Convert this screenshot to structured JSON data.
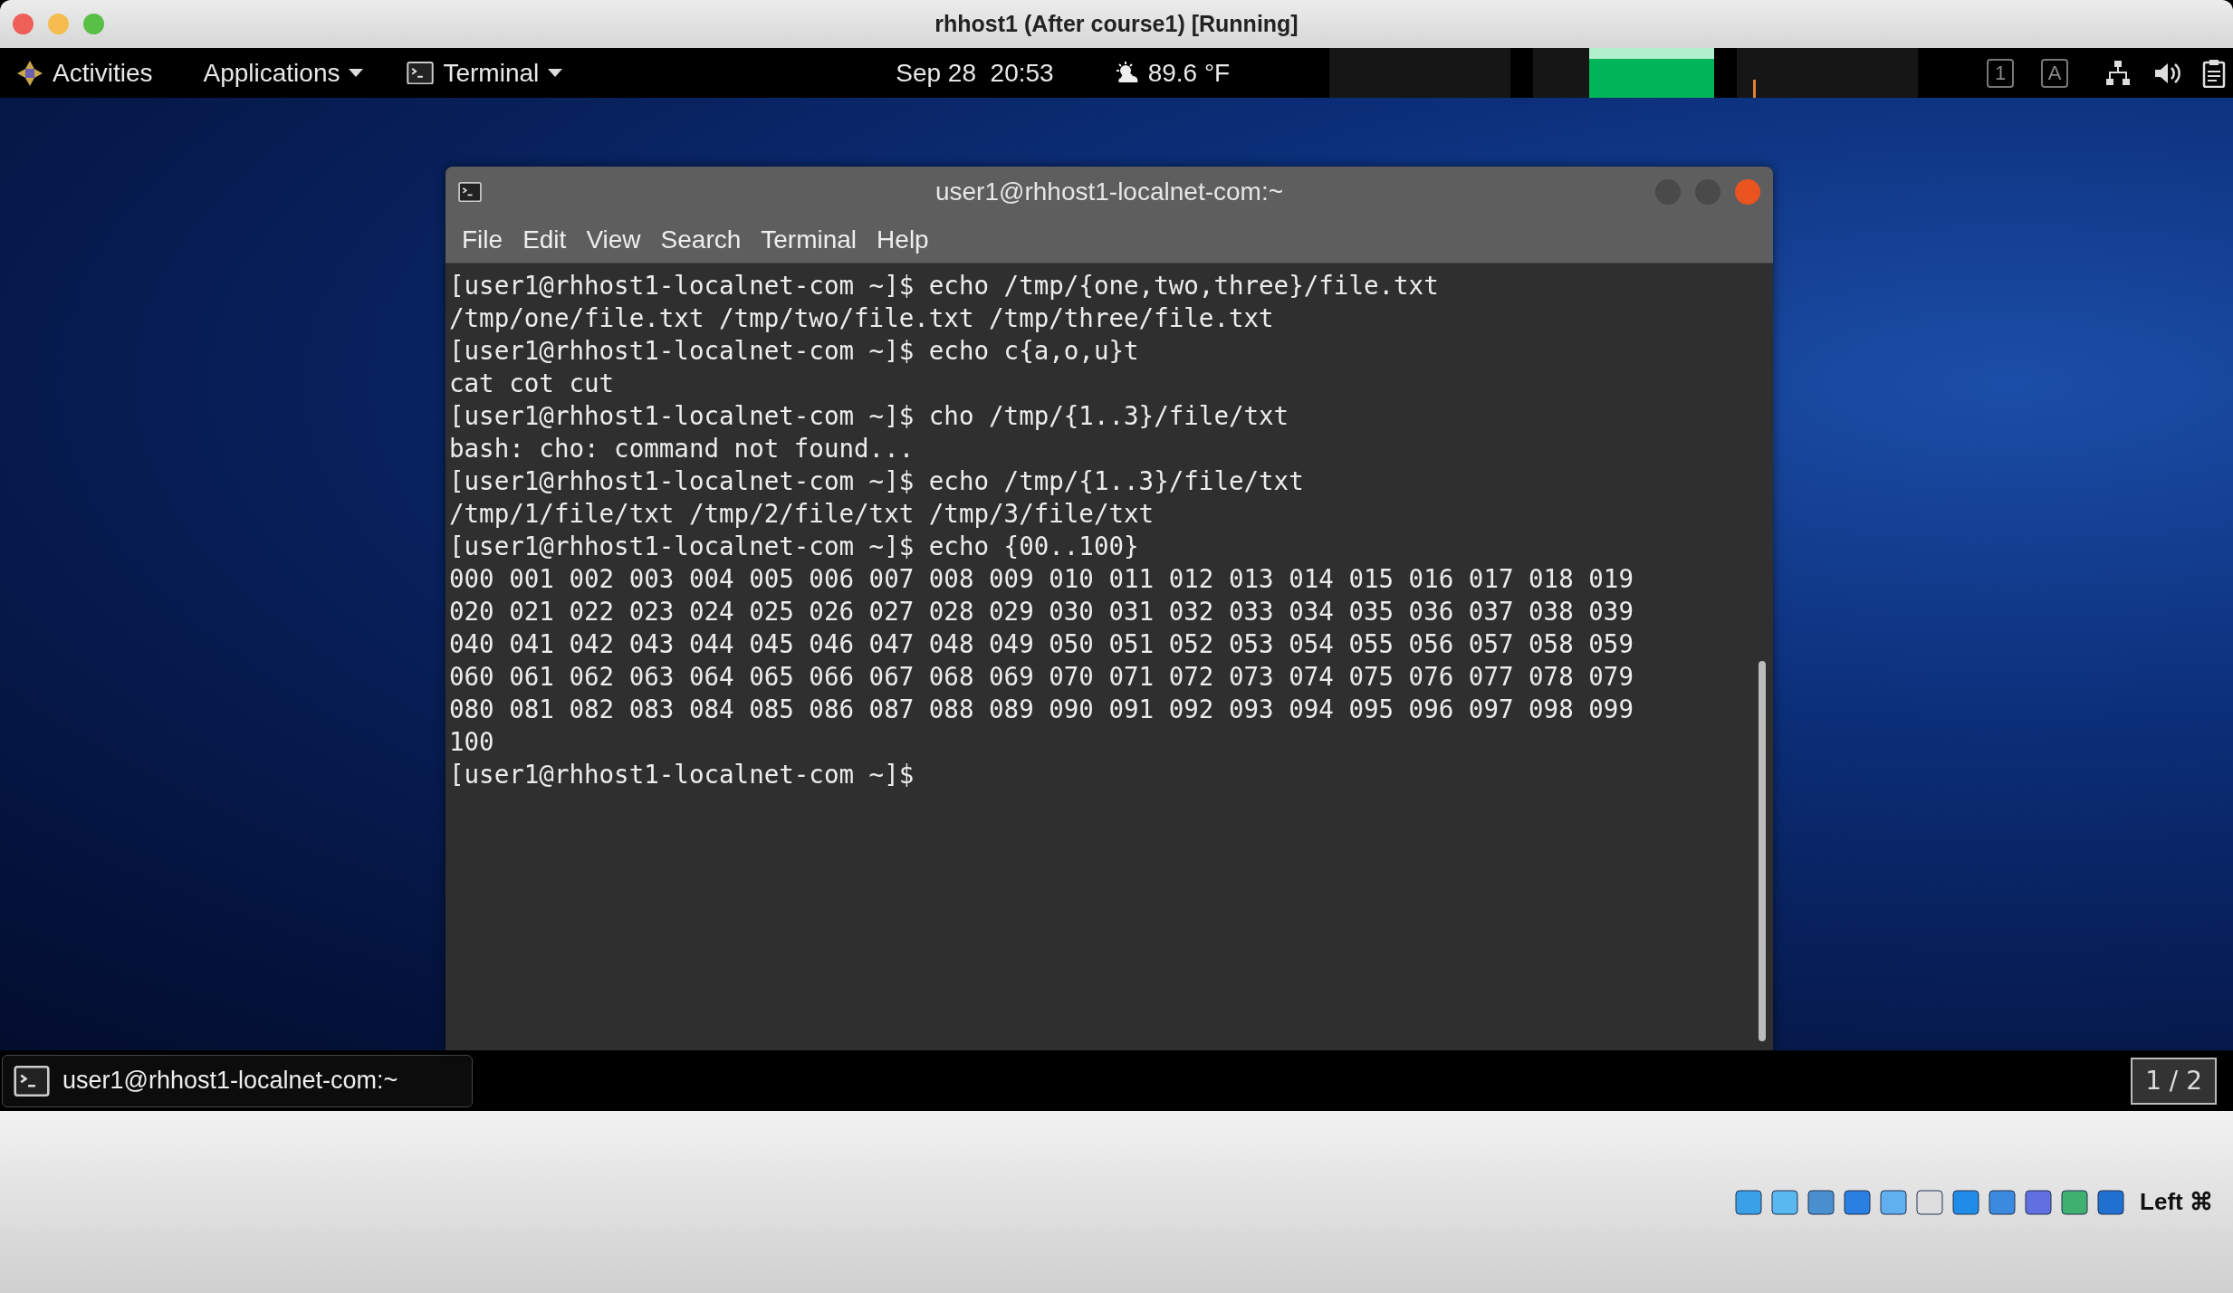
{
  "vm_window": {
    "title": "rhhost1 (After course1) [Running]"
  },
  "top_bar": {
    "activities": "Activities",
    "applications": "Applications",
    "app_menu": "Terminal",
    "clock": "Sep 28  20:53",
    "weather": "89.6 °F",
    "indicators": [
      "1",
      "A"
    ]
  },
  "terminal": {
    "title": "user1@rhhost1-localnet-com:~",
    "menu": [
      "File",
      "Edit",
      "View",
      "Search",
      "Terminal",
      "Help"
    ],
    "lines": [
      "[user1@rhhost1-localnet-com ~]$ echo /tmp/{one,two,three}/file.txt",
      "/tmp/one/file.txt /tmp/two/file.txt /tmp/three/file.txt",
      "[user1@rhhost1-localnet-com ~]$ echo c{a,o,u}t",
      "cat cot cut",
      "[user1@rhhost1-localnet-com ~]$ cho /tmp/{1..3}/file/txt",
      "bash: cho: command not found...",
      "[user1@rhhost1-localnet-com ~]$ echo /tmp/{1..3}/file/txt",
      "/tmp/1/file/txt /tmp/2/file/txt /tmp/3/file/txt",
      "[user1@rhhost1-localnet-com ~]$ echo {00..100}",
      "000 001 002 003 004 005 006 007 008 009 010 011 012 013 014 015 016 017 018 019",
      "020 021 022 023 024 025 026 027 028 029 030 031 032 033 034 035 036 037 038 039",
      "040 041 042 043 044 045 046 047 048 049 050 051 052 053 054 055 056 057 058 059",
      "060 061 062 063 064 065 066 067 068 069 070 071 072 073 074 075 076 077 078 079",
      "080 081 082 083 084 085 086 087 088 089 090 091 092 093 094 095 096 097 098 099",
      "100",
      "[user1@rhhost1-localnet-com ~]$"
    ]
  },
  "taskbar": {
    "window": "user1@rhhost1-localnet-com:~",
    "workspace": "1 / 2"
  },
  "vbox_status": {
    "host_key": "Left ⌘"
  }
}
